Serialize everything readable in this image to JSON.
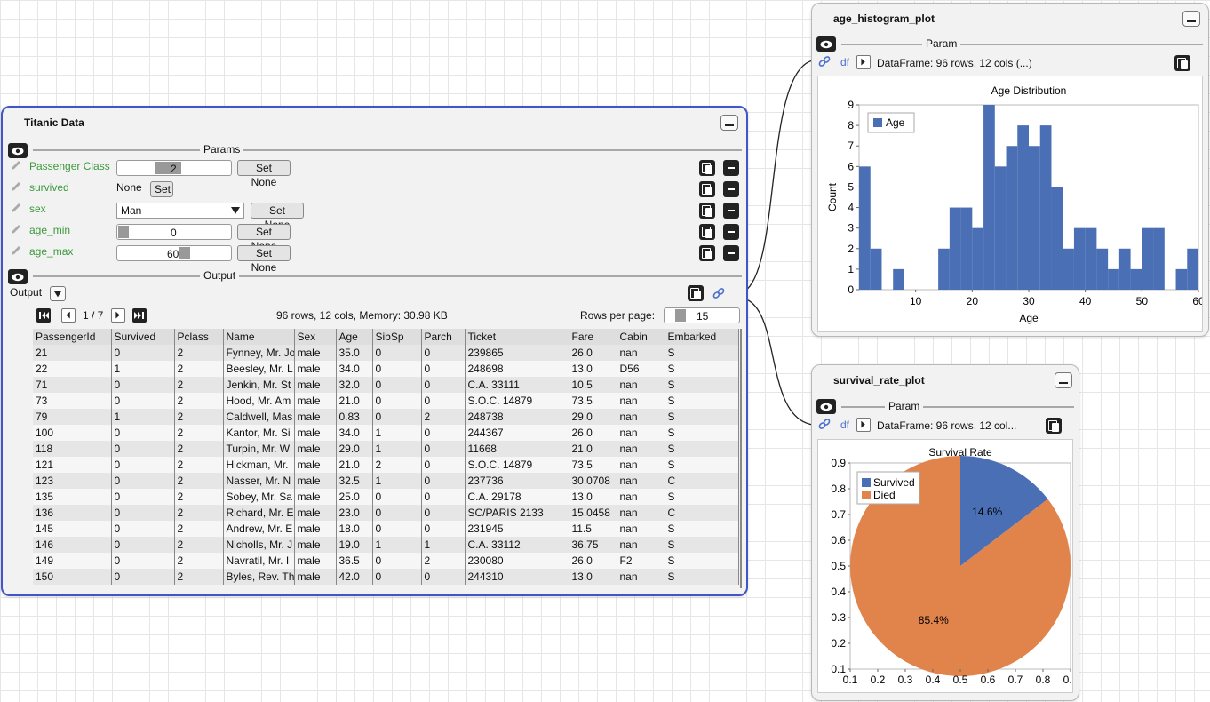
{
  "titanic": {
    "title": "Titanic Data",
    "params_label": "Params",
    "params": [
      {
        "label": "Passenger Class",
        "value": "2",
        "button": "Set None"
      },
      {
        "label": "survived",
        "value": "None",
        "button": "Set"
      },
      {
        "label": "sex",
        "value": "Man",
        "button": "Set None"
      },
      {
        "label": "age_min",
        "value": "0",
        "button": "Set None"
      },
      {
        "label": "age_max",
        "value": "60",
        "button": "Set None"
      }
    ],
    "output_label": "Output",
    "output_select": "Output",
    "pagination": "1 / 7",
    "summary": "96 rows, 12 cols, Memory: 30.98 KB",
    "rows_per_page_label": "Rows per page:",
    "rows_per_page": "15",
    "columns": [
      "PassengerId",
      "Survived",
      "Pclass",
      "Name",
      "Sex",
      "Age",
      "SibSp",
      "Parch",
      "Ticket",
      "Fare",
      "Cabin",
      "Embarked"
    ],
    "rows": [
      [
        "21",
        "0",
        "2",
        "Fynney, Mr. Jo",
        "male",
        "35.0",
        "0",
        "0",
        "239865",
        "26.0",
        "nan",
        "S"
      ],
      [
        "22",
        "1",
        "2",
        "Beesley, Mr. L",
        "male",
        "34.0",
        "0",
        "0",
        "248698",
        "13.0",
        "D56",
        "S"
      ],
      [
        "71",
        "0",
        "2",
        "Jenkin, Mr. St",
        "male",
        "32.0",
        "0",
        "0",
        "C.A. 33111",
        "10.5",
        "nan",
        "S"
      ],
      [
        "73",
        "0",
        "2",
        "Hood, Mr. Am",
        "male",
        "21.0",
        "0",
        "0",
        "S.O.C. 14879",
        "73.5",
        "nan",
        "S"
      ],
      [
        "79",
        "1",
        "2",
        "Caldwell, Mas",
        "male",
        "0.83",
        "0",
        "2",
        "248738",
        "29.0",
        "nan",
        "S"
      ],
      [
        "100",
        "0",
        "2",
        "Kantor, Mr. Si",
        "male",
        "34.0",
        "1",
        "0",
        "244367",
        "26.0",
        "nan",
        "S"
      ],
      [
        "118",
        "0",
        "2",
        "Turpin, Mr. W",
        "male",
        "29.0",
        "1",
        "0",
        "11668",
        "21.0",
        "nan",
        "S"
      ],
      [
        "121",
        "0",
        "2",
        "Hickman, Mr.",
        "male",
        "21.0",
        "2",
        "0",
        "S.O.C. 14879",
        "73.5",
        "nan",
        "S"
      ],
      [
        "123",
        "0",
        "2",
        "Nasser, Mr. N",
        "male",
        "32.5",
        "1",
        "0",
        "237736",
        "30.0708",
        "nan",
        "C"
      ],
      [
        "135",
        "0",
        "2",
        "Sobey, Mr. Sa",
        "male",
        "25.0",
        "0",
        "0",
        "C.A. 29178",
        "13.0",
        "nan",
        "S"
      ],
      [
        "136",
        "0",
        "2",
        "Richard, Mr. E",
        "male",
        "23.0",
        "0",
        "0",
        "SC/PARIS 2133",
        "15.0458",
        "nan",
        "C"
      ],
      [
        "145",
        "0",
        "2",
        "Andrew, Mr. E",
        "male",
        "18.0",
        "0",
        "0",
        "231945",
        "11.5",
        "nan",
        "S"
      ],
      [
        "146",
        "0",
        "2",
        "Nicholls, Mr. J",
        "male",
        "19.0",
        "1",
        "1",
        "C.A. 33112",
        "36.75",
        "nan",
        "S"
      ],
      [
        "149",
        "0",
        "2",
        "Navratil, Mr. I",
        "male",
        "36.5",
        "0",
        "2",
        "230080",
        "26.0",
        "F2",
        "S"
      ],
      [
        "150",
        "0",
        "2",
        "Byles, Rev. Th",
        "male",
        "42.0",
        "0",
        "0",
        "244310",
        "13.0",
        "nan",
        "S"
      ]
    ]
  },
  "age_node": {
    "title": "age_histogram_plot",
    "param_label": "Param",
    "df_label": "df",
    "df_value": "DataFrame: 96 rows, 12 cols (...)"
  },
  "survival_node": {
    "title": "survival_rate_plot",
    "param_label": "Param",
    "df_label": "df",
    "df_value": "DataFrame: 96 rows, 12 col..."
  },
  "colors": {
    "accent": "#4056c8",
    "series_blue": "#4a6fb5",
    "series_orange": "#e0844c",
    "param_green": "#3c9a3c"
  },
  "chart_data": [
    {
      "type": "bar",
      "title": "Age Distribution",
      "xlabel": "Age",
      "ylabel": "Count",
      "legend": [
        "Age"
      ],
      "legend_position": "top-left",
      "xlim": [
        0,
        60
      ],
      "ylim": [
        0,
        9
      ],
      "xticks": [
        10,
        20,
        30,
        40,
        50,
        60
      ],
      "yticks": [
        0,
        1,
        2,
        3,
        4,
        5,
        6,
        7,
        8,
        9
      ],
      "bin_width": 2,
      "bins": [
        {
          "x0": 0,
          "count": 6
        },
        {
          "x0": 2,
          "count": 2
        },
        {
          "x0": 4,
          "count": 0
        },
        {
          "x0": 6,
          "count": 1
        },
        {
          "x0": 8,
          "count": 0
        },
        {
          "x0": 10,
          "count": 0
        },
        {
          "x0": 12,
          "count": 0
        },
        {
          "x0": 14,
          "count": 2
        },
        {
          "x0": 16,
          "count": 4
        },
        {
          "x0": 18,
          "count": 4
        },
        {
          "x0": 20,
          "count": 3
        },
        {
          "x0": 22,
          "count": 9
        },
        {
          "x0": 24,
          "count": 6
        },
        {
          "x0": 26,
          "count": 7
        },
        {
          "x0": 28,
          "count": 8
        },
        {
          "x0": 30,
          "count": 7
        },
        {
          "x0": 32,
          "count": 8
        },
        {
          "x0": 34,
          "count": 5
        },
        {
          "x0": 36,
          "count": 2
        },
        {
          "x0": 38,
          "count": 3
        },
        {
          "x0": 40,
          "count": 3
        },
        {
          "x0": 42,
          "count": 2
        },
        {
          "x0": 44,
          "count": 1
        },
        {
          "x0": 46,
          "count": 2
        },
        {
          "x0": 48,
          "count": 1
        },
        {
          "x0": 50,
          "count": 3
        },
        {
          "x0": 52,
          "count": 3
        },
        {
          "x0": 54,
          "count": 0
        },
        {
          "x0": 56,
          "count": 1
        },
        {
          "x0": 58,
          "count": 2
        }
      ]
    },
    {
      "type": "pie",
      "title": "Survival Rate",
      "legend": [
        "Survived",
        "Died"
      ],
      "legend_position": "top-left",
      "slices": [
        {
          "label": "Survived",
          "value": 14.6,
          "text": "14.6%"
        },
        {
          "label": "Died",
          "value": 85.4,
          "text": "85.4%"
        }
      ],
      "xticks": [
        "0.1",
        "0.2",
        "0.3",
        "0.4",
        "0.5",
        "0.6",
        "0.7",
        "0.8",
        "0.9"
      ],
      "yticks": [
        "0.9",
        "0.8",
        "0.7",
        "0.6",
        "0.5",
        "0.4",
        "0.3",
        "0.2",
        "0.1"
      ]
    }
  ]
}
